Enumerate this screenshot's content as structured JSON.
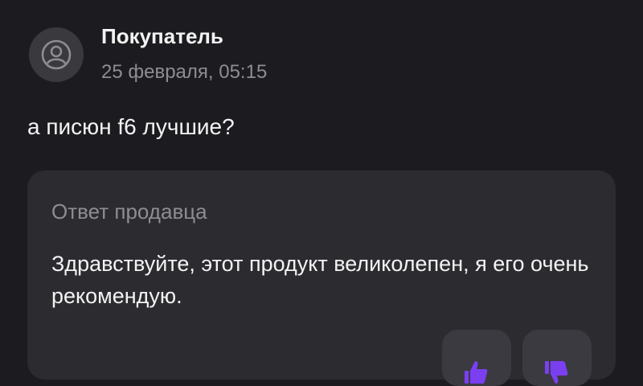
{
  "review": {
    "author": "Покупатель",
    "date": "25 февраля, 05:15",
    "avatar_icon": "user-icon",
    "text": "а писюн f6 лучшие?"
  },
  "seller_reply": {
    "title": "Ответ продавца",
    "text": "Здравствуйте, этот продукт великолепен, я его очень рекомендую."
  },
  "actions": [
    {
      "icon": "thumbs-up-icon"
    },
    {
      "icon": "thumbs-down-icon"
    }
  ],
  "colors": {
    "background": "#1c1b1f",
    "card": "#2c2b30",
    "secondary_text": "#8e8d93",
    "accent": "#7b3ff2"
  }
}
